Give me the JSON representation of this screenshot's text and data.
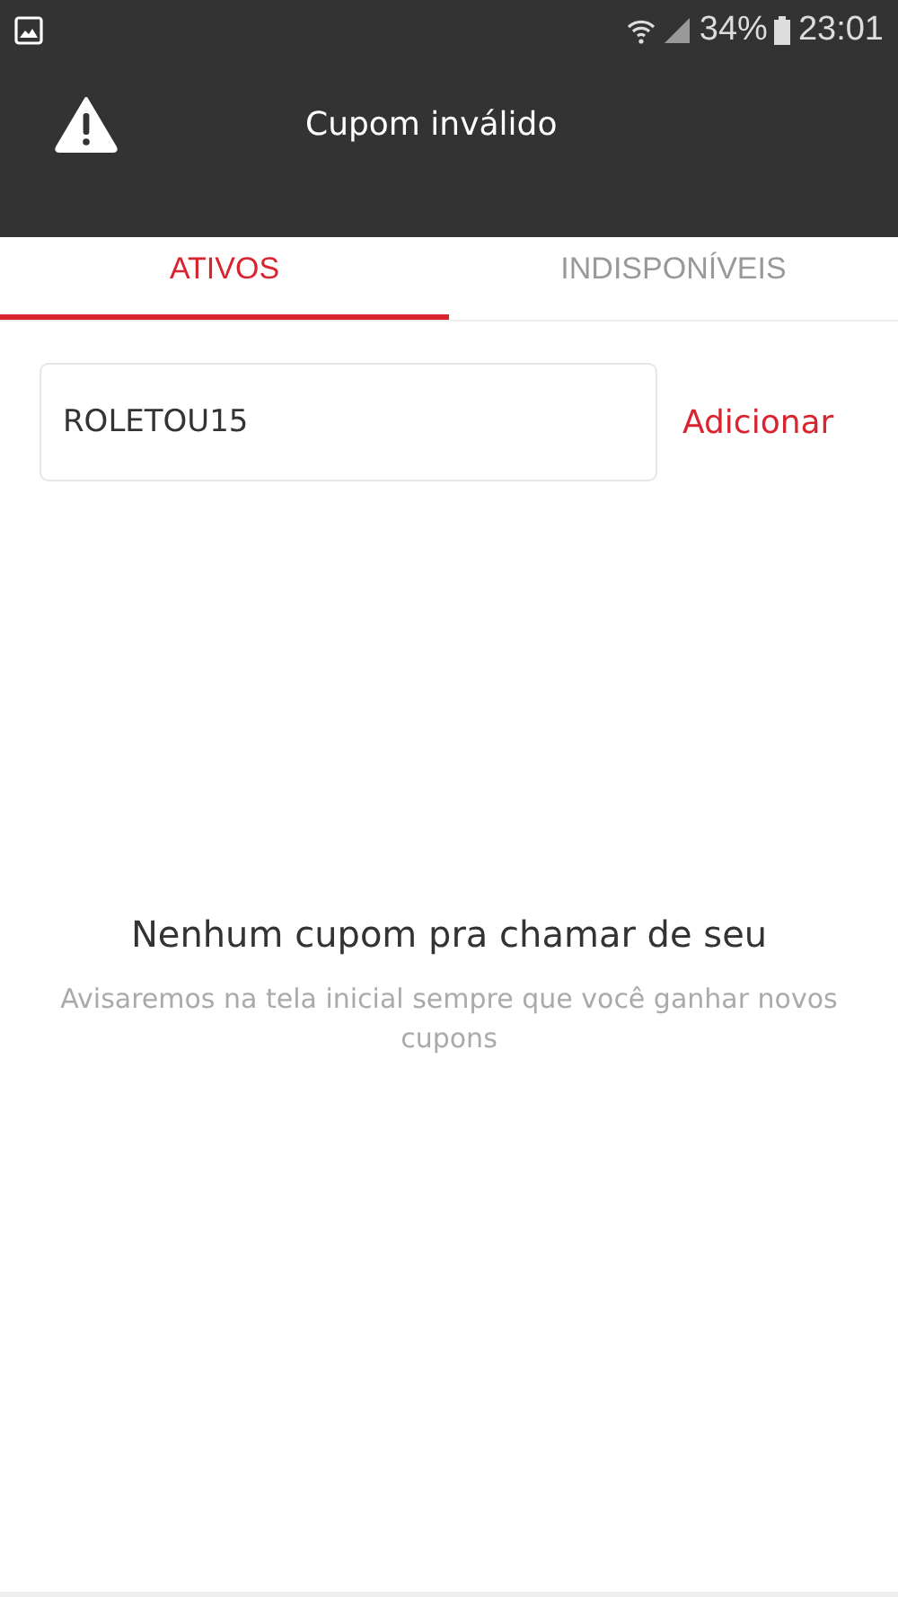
{
  "status_bar": {
    "battery": "34%",
    "time": "23:01"
  },
  "toast": {
    "title": "Cupom inválido"
  },
  "tabs": [
    {
      "label": "ATIVOS",
      "selected": true
    },
    {
      "label": "INDISPONÍVEIS",
      "selected": false
    }
  ],
  "coupon_input": {
    "value": "ROLETOU15"
  },
  "add_button": "Adicionar",
  "empty_state": {
    "title": "Nenhum cupom pra chamar de seu",
    "message": "Avisaremos na tela inicial sempre que você ganhar novos cupons"
  }
}
